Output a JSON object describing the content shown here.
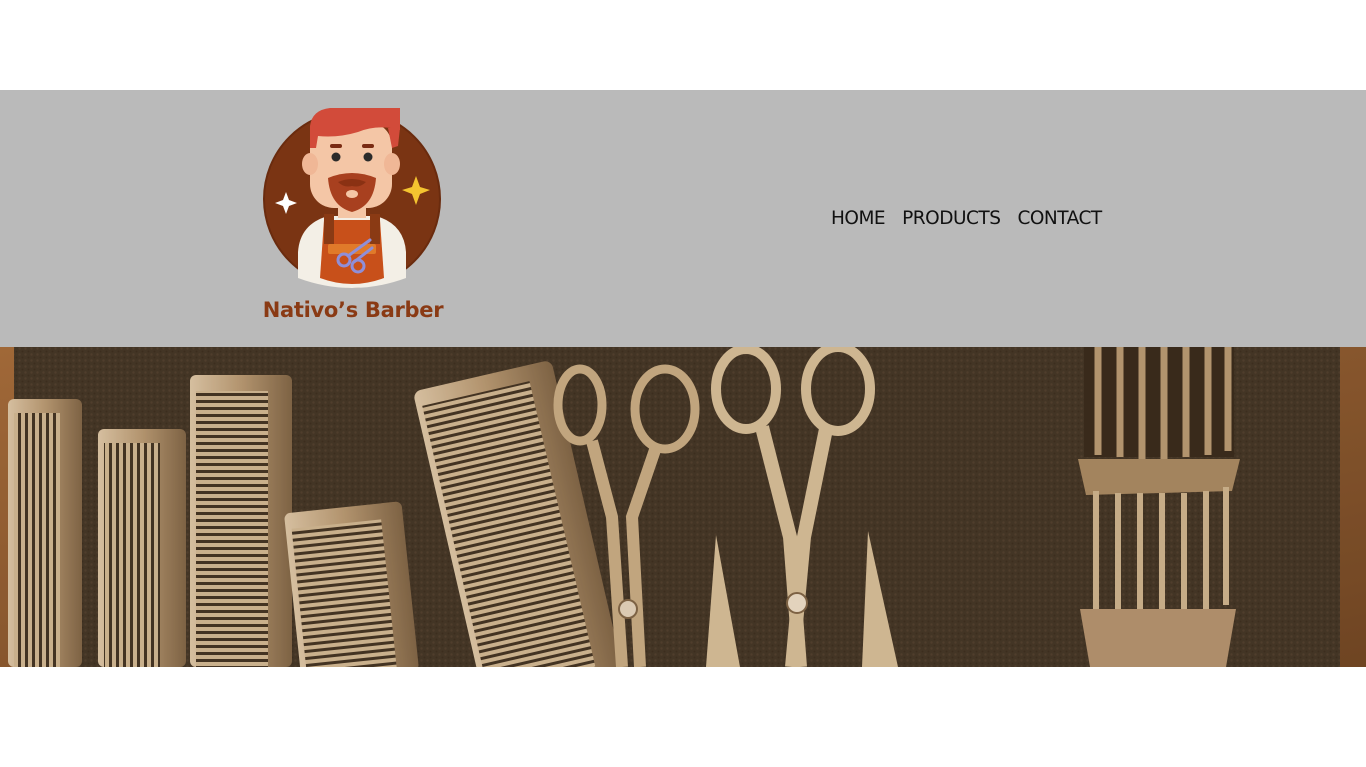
{
  "header": {
    "brand_name": "Nativo’s Barber",
    "logo_icon": "barber-mascot-icon"
  },
  "nav": {
    "items": [
      {
        "label": "HOME"
      },
      {
        "label": "PRODUCTS"
      },
      {
        "label": "CONTACT"
      }
    ]
  },
  "hero": {
    "image": "barber-tools-photo",
    "tools": [
      "comb",
      "comb",
      "comb",
      "comb",
      "comb",
      "scissors",
      "scissors",
      "thinning-scissors",
      "clipper-guard"
    ]
  },
  "colors": {
    "header_bg": "#bababa",
    "brand_text": "#8a3a14",
    "nav_text": "#111111",
    "hero_towel": "#3e3328",
    "hero_wood": "#8a5a32",
    "metal": "#c9b59a"
  }
}
